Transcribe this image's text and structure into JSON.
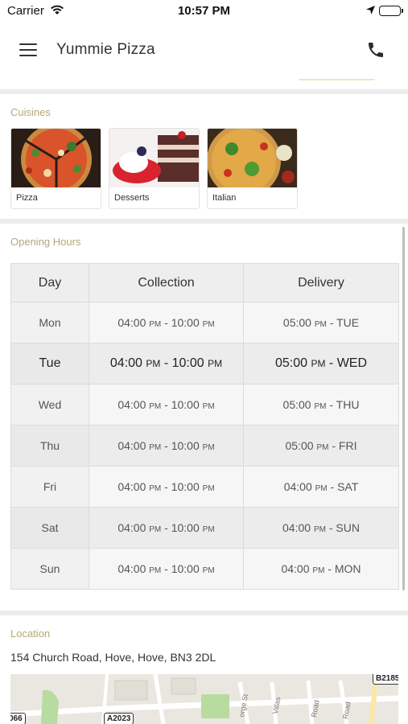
{
  "status_bar": {
    "carrier": "Carrier",
    "time": "10:57 PM"
  },
  "header": {
    "title": "Yummie Pizza"
  },
  "cuisines": {
    "title": "Cuisines",
    "items": [
      {
        "label": "Pizza"
      },
      {
        "label": "Desserts"
      },
      {
        "label": "Italian"
      }
    ]
  },
  "opening_hours": {
    "title": "Opening Hours",
    "columns": [
      "Day",
      "Collection",
      "Delivery"
    ],
    "rows": [
      {
        "day": "Mon",
        "c_start": "04:00",
        "c_start_ampm": "PM",
        "c_end": "10:00",
        "c_end_ampm": "PM",
        "d_start": "05:00",
        "d_ampm": "PM",
        "d_end_day": "TUE"
      },
      {
        "day": "Tue",
        "c_start": "04:00",
        "c_start_ampm": "PM",
        "c_end": "10:00",
        "c_end_ampm": "PM",
        "d_start": "05:00",
        "d_ampm": "PM",
        "d_end_day": "WED"
      },
      {
        "day": "Wed",
        "c_start": "04:00",
        "c_start_ampm": "PM",
        "c_end": "10:00",
        "c_end_ampm": "PM",
        "d_start": "05:00",
        "d_ampm": "PM",
        "d_end_day": "THU"
      },
      {
        "day": "Thu",
        "c_start": "04:00",
        "c_start_ampm": "PM",
        "c_end": "10:00",
        "c_end_ampm": "PM",
        "d_start": "05:00",
        "d_ampm": "PM",
        "d_end_day": "FRI"
      },
      {
        "day": "Fri",
        "c_start": "04:00",
        "c_start_ampm": "PM",
        "c_end": "10:00",
        "c_end_ampm": "PM",
        "d_start": "04:00",
        "d_ampm": "PM",
        "d_end_day": "SAT"
      },
      {
        "day": "Sat",
        "c_start": "04:00",
        "c_start_ampm": "PM",
        "c_end": "10:00",
        "c_end_ampm": "PM",
        "d_start": "04:00",
        "d_ampm": "PM",
        "d_end_day": "SUN"
      },
      {
        "day": "Sun",
        "c_start": "04:00",
        "c_start_ampm": "PM",
        "c_end": "10:00",
        "c_end_ampm": "PM",
        "d_start": "04:00",
        "d_ampm": "PM",
        "d_end_day": "MON"
      }
    ]
  },
  "location": {
    "title": "Location",
    "address": "154 Church Road, Hove, Hove, BN3 2DL",
    "map_labels": {
      "road_1": "B2185",
      "road_2": "066",
      "road_3": "A2023",
      "street_1": "orge St",
      "street_2": "Villas",
      "street_3": "Road",
      "street_4": "Road"
    }
  }
}
